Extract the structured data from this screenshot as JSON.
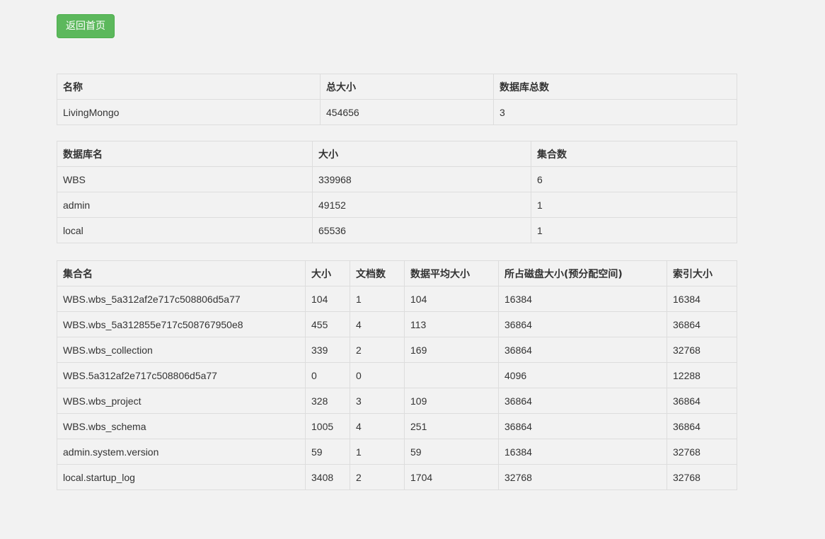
{
  "back_button": {
    "label": "返回首页"
  },
  "server_table": {
    "headers": [
      "名称",
      "总大小",
      "数据库总数"
    ],
    "rows": [
      [
        "LivingMongo",
        "454656",
        "3"
      ]
    ]
  },
  "db_table": {
    "headers": [
      "数据库名",
      "大小",
      "集合数"
    ],
    "rows": [
      [
        "WBS",
        "339968",
        "6"
      ],
      [
        "admin",
        "49152",
        "1"
      ],
      [
        "local",
        "65536",
        "1"
      ]
    ]
  },
  "collection_table": {
    "headers": [
      "集合名",
      "大小",
      "文档数",
      "数据平均大小",
      "所占磁盘大小(预分配空间)",
      "索引大小"
    ],
    "rows": [
      [
        "WBS.wbs_5a312af2e717c508806d5a77",
        "104",
        "1",
        "104",
        "16384",
        "16384"
      ],
      [
        "WBS.wbs_5a312855e717c508767950e8",
        "455",
        "4",
        "113",
        "36864",
        "36864"
      ],
      [
        "WBS.wbs_collection",
        "339",
        "2",
        "169",
        "36864",
        "32768"
      ],
      [
        "WBS.5a312af2e717c508806d5a77",
        "0",
        "0",
        "",
        "4096",
        "12288"
      ],
      [
        "WBS.wbs_project",
        "328",
        "3",
        "109",
        "36864",
        "36864"
      ],
      [
        "WBS.wbs_schema",
        "1005",
        "4",
        "251",
        "36864",
        "36864"
      ],
      [
        "admin.system.version",
        "59",
        "1",
        "59",
        "16384",
        "32768"
      ],
      [
        "local.startup_log",
        "3408",
        "2",
        "1704",
        "32768",
        "32768"
      ]
    ]
  }
}
